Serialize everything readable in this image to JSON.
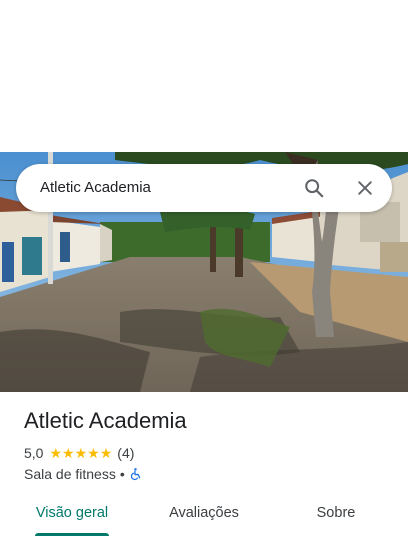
{
  "search": {
    "query": "Atletic Academia",
    "search_icon": "search-icon",
    "close_icon": "close-icon"
  },
  "photo": {
    "description_icon": "street-photo"
  },
  "place": {
    "name": "Atletic Academia",
    "rating": "5,0",
    "stars": 5,
    "review_count": "(4)",
    "category": "Sala de fitness",
    "separator": "•",
    "accessibility_icon": "wheelchair-icon"
  },
  "tabs": [
    {
      "label": "Visão geral",
      "active": true
    },
    {
      "label": "Avaliações",
      "active": false
    },
    {
      "label": "Sobre",
      "active": false
    }
  ],
  "colors": {
    "accent": "#00796b",
    "star": "#fbbc04",
    "accessibility": "#1a73e8",
    "text_primary": "#202124",
    "text_secondary": "#3c4043"
  }
}
